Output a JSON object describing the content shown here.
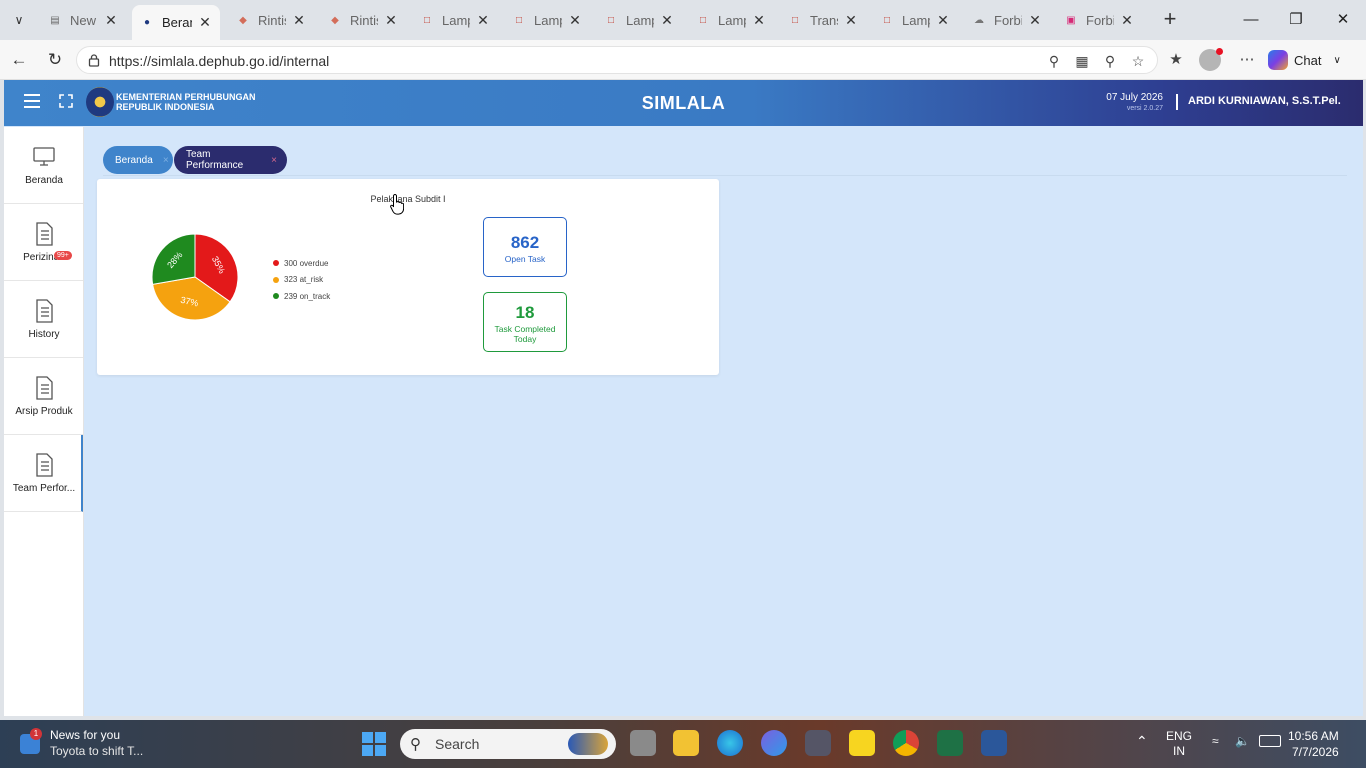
{
  "browser": {
    "tabs": [
      {
        "title": "New tab",
        "icon": "new-tab-icon",
        "active": false
      },
      {
        "title": "Beranda",
        "icon": "ministry-favicon",
        "active": true
      },
      {
        "title": "Rintisan",
        "icon": "rintisan-favicon",
        "active": false
      },
      {
        "title": "Rintisan",
        "icon": "rintisan-favicon",
        "active": false
      },
      {
        "title": "Lampiran",
        "icon": "pdf-icon",
        "active": false
      },
      {
        "title": "Lampiran",
        "icon": "pdf-icon",
        "active": false
      },
      {
        "title": "Lampiran",
        "icon": "pdf-icon",
        "active": false
      },
      {
        "title": "Lampiran",
        "icon": "pdf-icon",
        "active": false
      },
      {
        "title": "Transkrip",
        "icon": "pdf-icon",
        "active": false
      },
      {
        "title": "Lampiran",
        "icon": "pdf-icon",
        "active": false
      },
      {
        "title": "Forbis",
        "icon": "forbis-favicon",
        "active": false
      },
      {
        "title": "Forbis",
        "icon": "instagram-icon",
        "active": false
      }
    ],
    "url": "https://simlala.dephub.go.id/internal",
    "chat_label": "Chat"
  },
  "app": {
    "ministry_line1": "KEMENTERIAN PERHUBUNGAN",
    "ministry_line2": "REPUBLIK INDONESIA",
    "title": "SIMLALA",
    "date": "07 July 2026",
    "version": "versi 2.0.27",
    "user": "ARDI KURNIAWAN, S.S.T.Pel."
  },
  "sidebar": {
    "items": [
      {
        "label": "Beranda",
        "icon": "monitor-icon",
        "badge": ""
      },
      {
        "label": "Perizinan",
        "icon": "document-icon",
        "badge": "99+"
      },
      {
        "label": "History",
        "icon": "document-icon",
        "badge": ""
      },
      {
        "label": "Arsip Produk",
        "icon": "document-icon",
        "badge": ""
      },
      {
        "label": "Team Perfor...",
        "icon": "document-icon",
        "badge": ""
      }
    ]
  },
  "breadcrumbs": [
    {
      "label": "Beranda",
      "close": "×"
    },
    {
      "label": "Team Performance",
      "close": "×"
    }
  ],
  "card": {
    "title": "Pelaksana Subdit I",
    "legend": [
      {
        "label": "300 overdue",
        "color": "#e3191a"
      },
      {
        "label": "323 at_risk",
        "color": "#f5a20f"
      },
      {
        "label": "239 on_track",
        "color": "#1f8a1f"
      }
    ],
    "open_task": {
      "value": "862",
      "label": "Open Task"
    },
    "completed_today": {
      "value": "18",
      "label": "Task Completed Today"
    }
  },
  "chart_data": {
    "type": "pie",
    "categories": [
      "overdue",
      "at_risk",
      "on_track"
    ],
    "values": [
      300,
      323,
      239
    ],
    "slice_labels": [
      "35%",
      "37%",
      "28%"
    ],
    "colors": [
      "#e3191a",
      "#f5a20f",
      "#1f8a1f"
    ],
    "title": "Pelaksana Subdit I",
    "legend_position": "right"
  },
  "taskbar": {
    "news_badge": "1",
    "news_title": "News for you",
    "news_sub": "Toyota to shift T...",
    "search_placeholder": "Search",
    "lang_1": "ENG",
    "lang_2": "IN",
    "time": "10:56 AM",
    "date": "7/7/2026"
  }
}
